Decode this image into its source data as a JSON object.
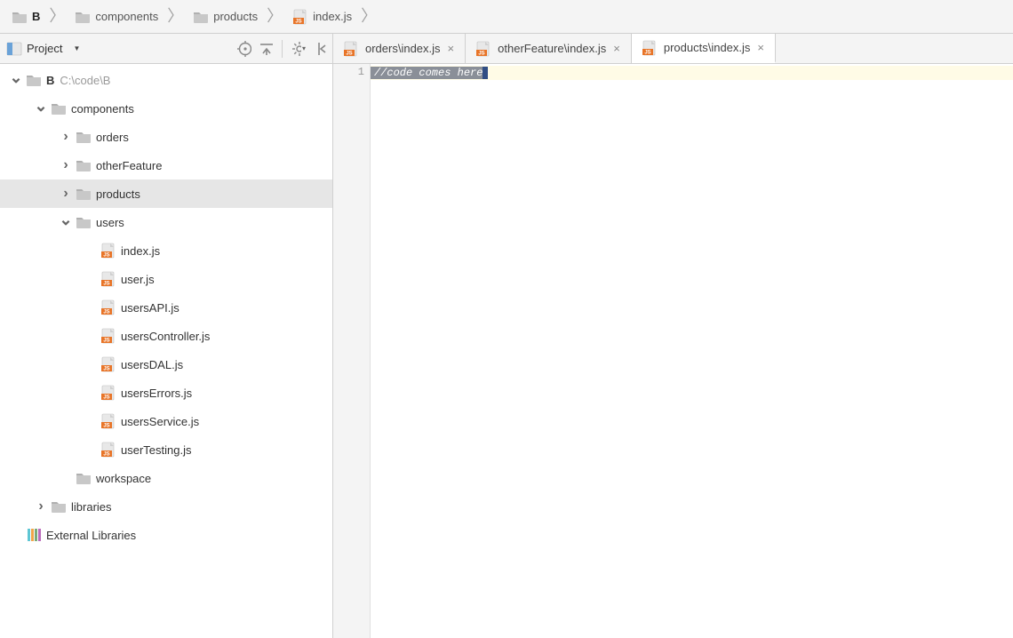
{
  "breadcrumbs": [
    {
      "label": "B",
      "icon": "folder",
      "bold": true
    },
    {
      "label": "components",
      "icon": "folder",
      "bold": false
    },
    {
      "label": "products",
      "icon": "folder",
      "bold": false
    },
    {
      "label": "index.js",
      "icon": "js",
      "bold": false
    }
  ],
  "sidebar": {
    "title": "Project",
    "tools": [
      "scroll-from-source",
      "collapse-all",
      "settings",
      "hide"
    ]
  },
  "tree": [
    {
      "depth": 0,
      "twisty": "open",
      "icon": "folder",
      "label": "B",
      "suffix": "C:\\code\\B",
      "bold": true,
      "selected": false
    },
    {
      "depth": 1,
      "twisty": "open",
      "icon": "folder",
      "label": "components",
      "selected": false
    },
    {
      "depth": 2,
      "twisty": "closed",
      "icon": "folder",
      "label": "orders",
      "selected": false
    },
    {
      "depth": 2,
      "twisty": "closed",
      "icon": "folder",
      "label": "otherFeature",
      "selected": false
    },
    {
      "depth": 2,
      "twisty": "closed",
      "icon": "folder",
      "label": "products",
      "selected": true
    },
    {
      "depth": 2,
      "twisty": "open",
      "icon": "folder",
      "label": "users",
      "selected": false
    },
    {
      "depth": 3,
      "twisty": "none",
      "icon": "js",
      "label": "index.js",
      "selected": false
    },
    {
      "depth": 3,
      "twisty": "none",
      "icon": "js",
      "label": "user.js",
      "selected": false
    },
    {
      "depth": 3,
      "twisty": "none",
      "icon": "js",
      "label": "usersAPI.js",
      "selected": false
    },
    {
      "depth": 3,
      "twisty": "none",
      "icon": "js",
      "label": "usersController.js",
      "selected": false
    },
    {
      "depth": 3,
      "twisty": "none",
      "icon": "js",
      "label": "usersDAL.js",
      "selected": false
    },
    {
      "depth": 3,
      "twisty": "none",
      "icon": "js",
      "label": "usersErrors.js",
      "selected": false
    },
    {
      "depth": 3,
      "twisty": "none",
      "icon": "js",
      "label": "usersService.js",
      "selected": false
    },
    {
      "depth": 3,
      "twisty": "none",
      "icon": "js",
      "label": "userTesting.js",
      "selected": false
    },
    {
      "depth": 2,
      "twisty": "none",
      "icon": "folder",
      "label": "workspace",
      "selected": false
    },
    {
      "depth": 1,
      "twisty": "closed",
      "icon": "folder",
      "label": "libraries",
      "selected": false
    },
    {
      "depth": 0,
      "twisty": "none",
      "icon": "extlib",
      "label": "External Libraries",
      "selected": false
    }
  ],
  "tabs": [
    {
      "label": "orders\\index.js",
      "icon": "js",
      "active": false
    },
    {
      "label": "otherFeature\\index.js",
      "icon": "js",
      "active": false
    },
    {
      "label": "products\\index.js",
      "icon": "js",
      "active": true
    }
  ],
  "editor": {
    "line_number": "1",
    "code_line_1": "//code comes here"
  }
}
